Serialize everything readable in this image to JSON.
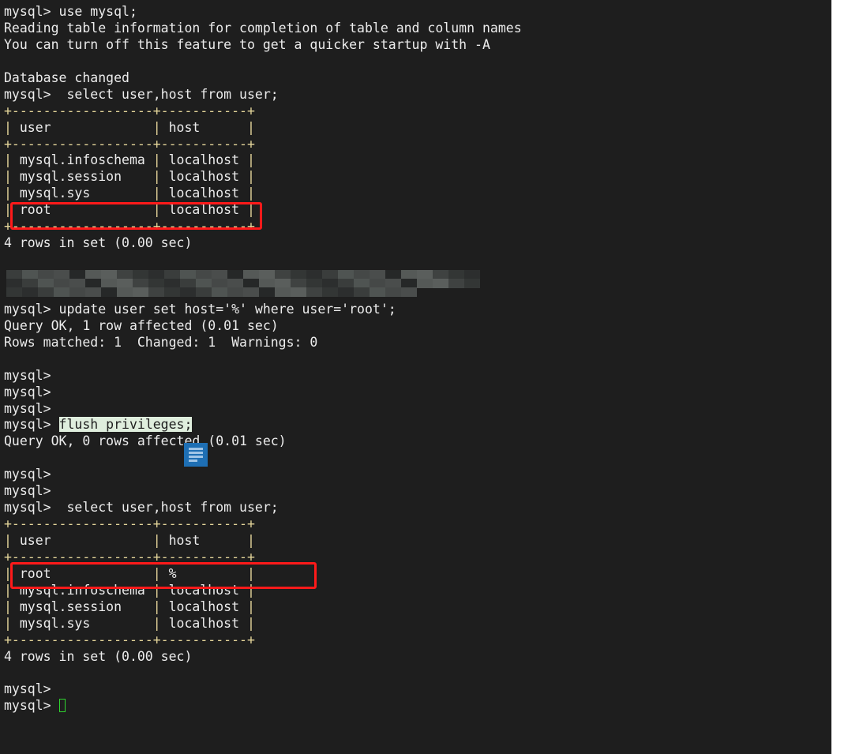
{
  "terminal": {
    "colors": {
      "background": "#1e1e1e",
      "text": "#ececec",
      "table_border": "#e6d79b",
      "highlight_box": "#ff1a1a",
      "selection": "#dfeedd",
      "cursor": "#2fd42f"
    },
    "lines": [
      {
        "text": "mysql> use mysql;"
      },
      {
        "text": "Reading table information for completion of table and column names"
      },
      {
        "text": "You can turn off this feature to get a quicker startup with -A"
      },
      {
        "text": ""
      },
      {
        "text": "Database changed"
      },
      {
        "text": "mysql>  select user,host from user;"
      },
      {
        "text": "+------------------+-----------+",
        "table": true
      },
      {
        "text": "| user             | host      |",
        "table": true
      },
      {
        "text": "+------------------+-----------+",
        "table": true
      },
      {
        "text": "| mysql.infoschema | localhost |",
        "table": true
      },
      {
        "text": "| mysql.session    | localhost |",
        "table": true
      },
      {
        "text": "| mysql.sys        | localhost |",
        "table": true
      },
      {
        "text": "| root             | localhost |",
        "table": true
      },
      {
        "text": "+------------------+-----------+",
        "table": true
      },
      {
        "text": "4 rows in set (0.00 sec)"
      },
      {
        "text": ""
      },
      {
        "text": "",
        "redacted": true
      },
      {
        "text": "",
        "redacted": true
      },
      {
        "text": "mysql> update user set host='%' where user='root';"
      },
      {
        "text": "Query OK, 1 row affected (0.01 sec)"
      },
      {
        "text": "Rows matched: 1  Changed: 1  Warnings: 0"
      },
      {
        "text": ""
      },
      {
        "text": "mysql>"
      },
      {
        "text": "mysql>"
      },
      {
        "text": "mysql>"
      },
      {
        "text": "mysql> ",
        "selected": "flush privileges;"
      },
      {
        "text": "Query OK, 0 rows affected (0.01 sec)"
      },
      {
        "text": ""
      },
      {
        "text": "mysql>"
      },
      {
        "text": "mysql>"
      },
      {
        "text": "mysql>  select user,host from user;"
      },
      {
        "text": "+------------------+-----------+",
        "table": true
      },
      {
        "text": "| user             | host      |",
        "table": true
      },
      {
        "text": "+------------------+-----------+",
        "table": true
      },
      {
        "text": "| root             | %         |",
        "table": true
      },
      {
        "text": "| mysql.infoschema | localhost |",
        "table": true
      },
      {
        "text": "| mysql.session    | localhost |",
        "table": true
      },
      {
        "text": "| mysql.sys        | localhost |",
        "table": true
      },
      {
        "text": "+------------------+-----------+",
        "table": true
      },
      {
        "text": "4 rows in set (0.00 sec)"
      },
      {
        "text": ""
      },
      {
        "text": "mysql>"
      },
      {
        "text": "mysql> ",
        "cursor": true
      }
    ]
  },
  "overlays": {
    "note_icon": "notepad-icon",
    "highlights": [
      "root-localhost-row",
      "root-percent-row"
    ]
  }
}
